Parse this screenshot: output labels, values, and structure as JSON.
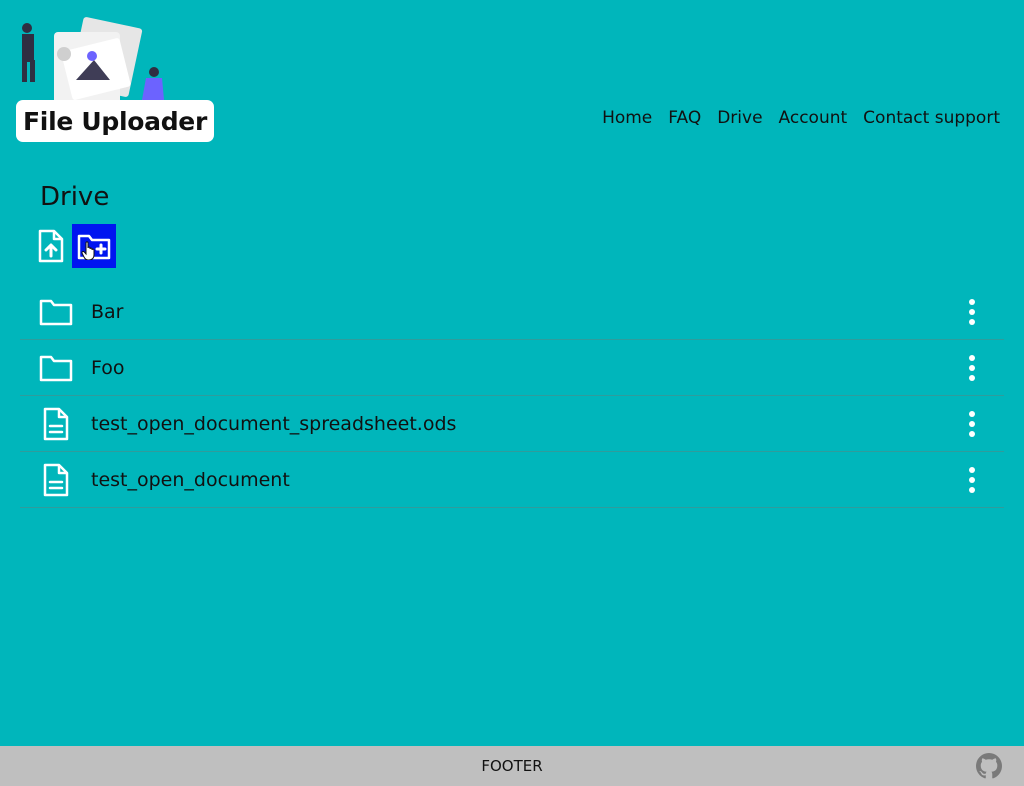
{
  "header": {
    "logo_text": "File Uploader",
    "nav": [
      {
        "label": "Home",
        "icon": ""
      },
      {
        "label": "FAQ",
        "icon": ""
      },
      {
        "label": "Drive",
        "icon": ""
      },
      {
        "label": "Account",
        "icon": ""
      },
      {
        "label": "Contact support",
        "icon": ""
      }
    ]
  },
  "main": {
    "title": "Drive",
    "actions": [
      {
        "icon": "upload-file-icon"
      },
      {
        "icon": "new-folder-icon",
        "active": true
      }
    ],
    "items": [
      {
        "type": "folder",
        "icon": "folder-icon",
        "name": "Bar"
      },
      {
        "type": "folder",
        "icon": "folder-icon",
        "name": "Foo"
      },
      {
        "type": "file",
        "icon": "document-icon",
        "name": "test_open_document_spreadsheet.ods"
      },
      {
        "type": "file",
        "icon": "document-icon",
        "name": "test_open_document"
      }
    ]
  },
  "footer": {
    "text": "FOOTER",
    "icon": "github-icon"
  },
  "colors": {
    "background": "#00b6bb",
    "accent_button": "#0015f0",
    "footer": "#bfbfbf"
  }
}
